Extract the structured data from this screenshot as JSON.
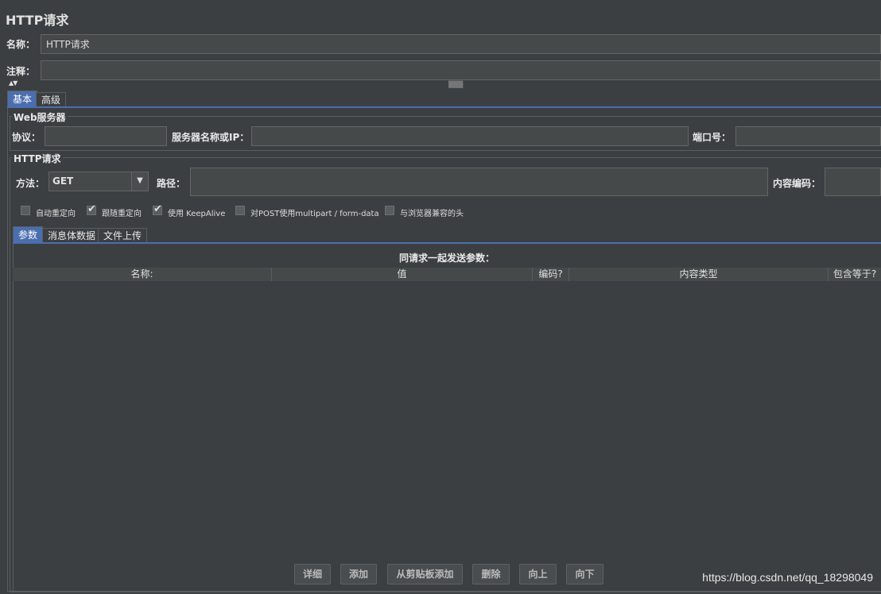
{
  "page": {
    "title": "HTTP请求"
  },
  "name_row": {
    "label": "名称：",
    "value": "HTTP请求"
  },
  "comment_row": {
    "label": "注释：",
    "value": ""
  },
  "tabs": [
    {
      "label": "基本",
      "active": true
    },
    {
      "label": "高级",
      "active": false
    }
  ],
  "web_server": {
    "title": "Web服务器",
    "protocol_label": "协议：",
    "protocol_value": "",
    "server_label": "服务器名称或IP：",
    "server_value": "",
    "port_label": "端口号：",
    "port_value": ""
  },
  "http_request": {
    "title": "HTTP请求",
    "method_label": "方法：",
    "method_value": "GET",
    "path_label": "路径：",
    "path_value": "",
    "encoding_label": "内容编码：",
    "encoding_value": ""
  },
  "options": [
    {
      "label": "自动重定向",
      "checked": false
    },
    {
      "label": "跟随重定向",
      "checked": true
    },
    {
      "label": "使用 KeepAlive",
      "checked": true
    },
    {
      "label": "对POST使用multipart / form-data",
      "checked": false
    },
    {
      "label": "与浏览器兼容的头",
      "checked": false
    }
  ],
  "sub_tabs": [
    {
      "label": "参数",
      "active": true
    },
    {
      "label": "消息体数据",
      "active": false
    },
    {
      "label": "文件上传",
      "active": false
    }
  ],
  "params": {
    "caption": "同请求一起发送参数：",
    "columns": [
      "名称:",
      "值",
      "编码?",
      "内容类型",
      "包含等于?"
    ],
    "rows": []
  },
  "buttons": {
    "detail": "详细",
    "add": "添加",
    "add_clipboard": "从剪贴板添加",
    "delete": "删除",
    "up": "向上",
    "down": "向下"
  },
  "watermark": "https://blog.csdn.net/qq_18298049",
  "colors": {
    "background": "#3c3f41",
    "field": "#45494a",
    "accent": "#4b6eaf"
  }
}
